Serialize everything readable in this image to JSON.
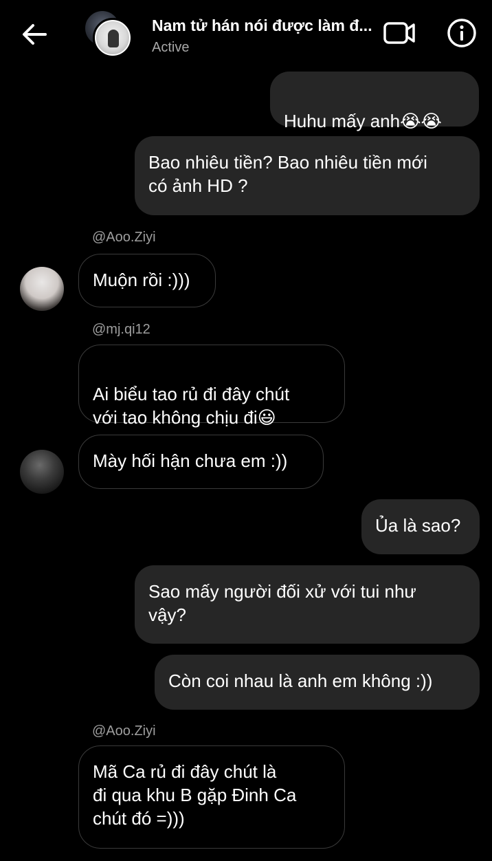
{
  "header": {
    "title": "Nam tử hán nói được làm đ...",
    "status": "Active",
    "back_icon": "arrow-left-icon",
    "video_icon": "video-call-icon",
    "info_icon": "info-icon"
  },
  "messages": [
    {
      "type": "outgoing",
      "text": "Huhu mấy anh",
      "emoji": "😭😭"
    },
    {
      "type": "outgoing",
      "text": "Bao nhiêu tiền? Bao nhiêu tiền mới\ncó ảnh HD ?"
    },
    {
      "type": "reply_label",
      "text": "@Aoo.Ziyi"
    },
    {
      "type": "incoming",
      "text": "Muộn rồi :)))"
    },
    {
      "type": "reply_label",
      "text": "@mj.qi12"
    },
    {
      "type": "incoming",
      "text": "Ai biểu tao rủ đi đây chút\nvới tao không chịu đi",
      "emoji": "😃"
    },
    {
      "type": "incoming",
      "text": "Mày hối hận chưa em :))"
    },
    {
      "type": "outgoing",
      "text": "Ủa là sao?"
    },
    {
      "type": "outgoing",
      "text": "Sao mấy người đối xử với tui như\nvậy?"
    },
    {
      "type": "outgoing",
      "text": "Còn coi nhau là anh em không :))"
    },
    {
      "type": "reply_label",
      "text": "@Aoo.Ziyi"
    },
    {
      "type": "incoming",
      "text": "Mã Ca rủ đi đây chút là\nđi qua khu B gặp Đinh Ca\nchút đó =)))"
    }
  ],
  "colors": {
    "background": "#000000",
    "outgoing_bubble": "#262626",
    "incoming_border": "#3b3b3b",
    "secondary_text": "#a8a8a8"
  }
}
